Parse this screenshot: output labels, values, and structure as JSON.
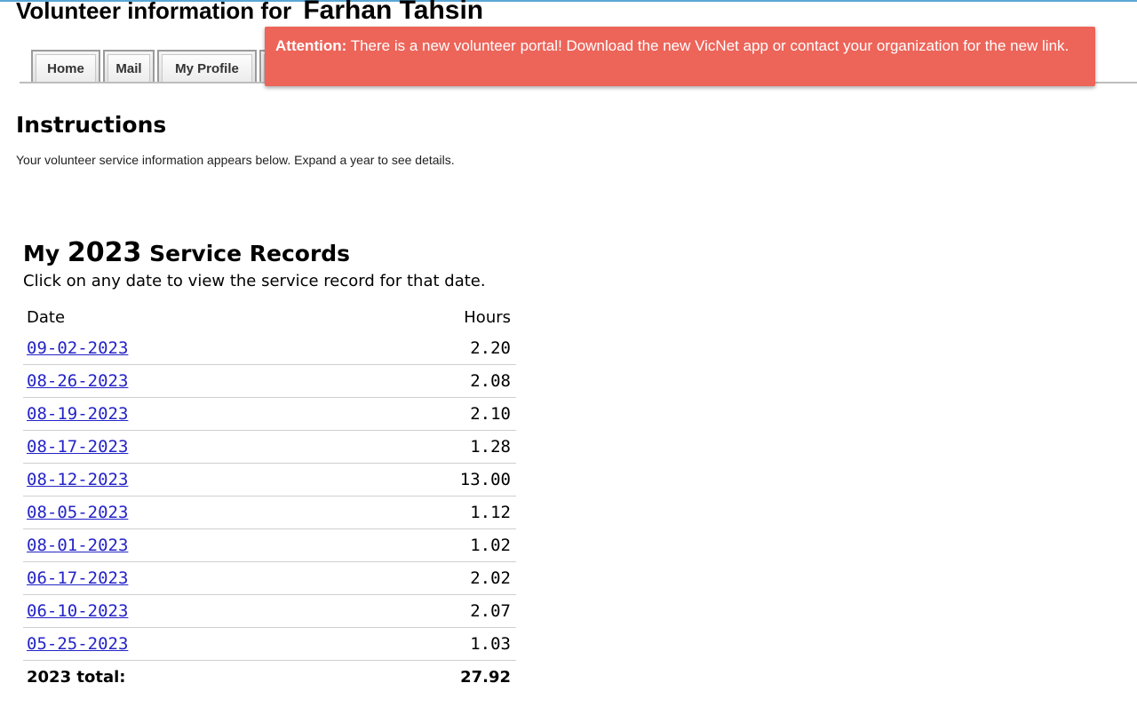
{
  "header": {
    "label": "Volunteer information for",
    "volunteer_name": "Farhan Tahsin"
  },
  "tabs": [
    {
      "label": "Home"
    },
    {
      "label": "Mail"
    },
    {
      "label": "My Profile"
    }
  ],
  "alert": {
    "strong": "Attention:",
    "message": "There is a new volunteer portal! Download the new VicNet app or contact your organization for the new link."
  },
  "instructions": {
    "title": "Instructions",
    "text": "Your volunteer service information appears below. Expand a year to see details."
  },
  "records": {
    "title_prefix": "My",
    "year": "2023",
    "title_suffix": "Service Records",
    "subtitle": "Click on any date to view the service record for that date.",
    "columns": {
      "date": "Date",
      "hours": "Hours"
    },
    "rows": [
      {
        "date": "09-02-2023",
        "hours": "2.20"
      },
      {
        "date": "08-26-2023",
        "hours": "2.08"
      },
      {
        "date": "08-19-2023",
        "hours": "2.10"
      },
      {
        "date": "08-17-2023",
        "hours": "1.28"
      },
      {
        "date": "08-12-2023",
        "hours": "13.00"
      },
      {
        "date": "08-05-2023",
        "hours": "1.12"
      },
      {
        "date": "08-01-2023",
        "hours": "1.02"
      },
      {
        "date": "06-17-2023",
        "hours": "2.02"
      },
      {
        "date": "06-10-2023",
        "hours": "2.07"
      },
      {
        "date": "05-25-2023",
        "hours": "1.03"
      }
    ],
    "total_label": "2023 total:",
    "total_value": "27.92"
  },
  "colors": {
    "alert_bg": "#ed6459",
    "link": "#2424c7"
  }
}
